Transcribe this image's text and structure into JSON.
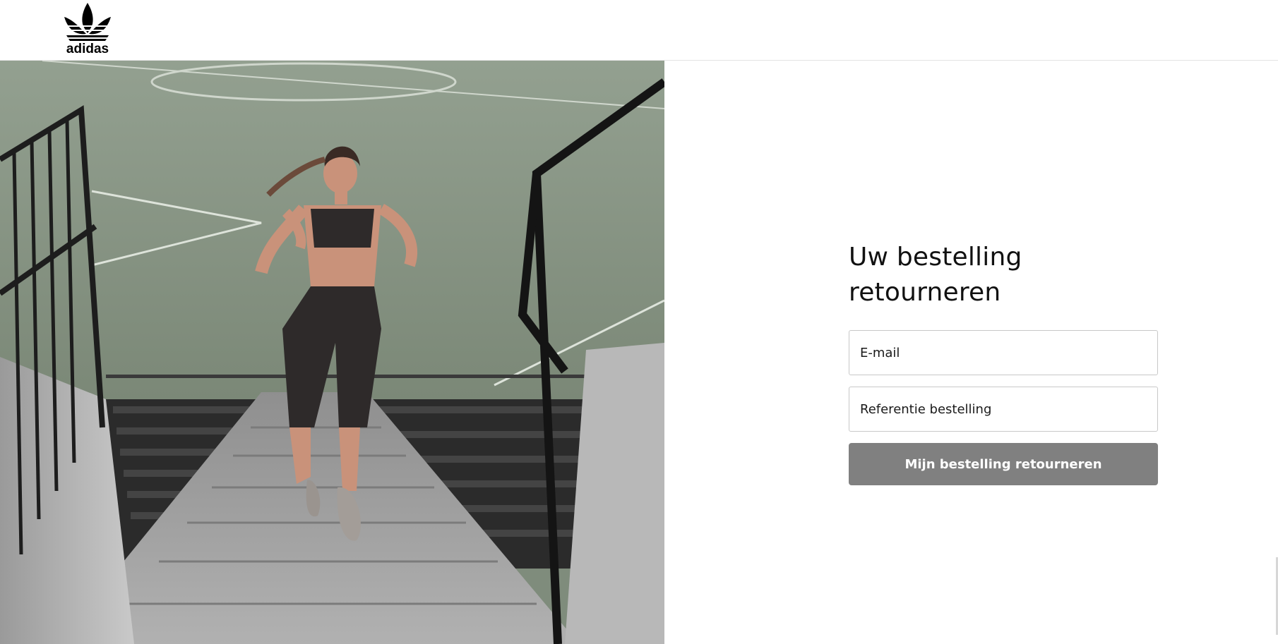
{
  "header": {
    "logo_text": "adidas",
    "logo_icon": "adidas-trefoil-icon"
  },
  "hero": {
    "image": "woman-running-up-stadium-stairs"
  },
  "form": {
    "title": "Uw bestelling retourneren",
    "email_placeholder": "E-mail",
    "email_value": "",
    "reference_placeholder": "Referentie bestelling",
    "reference_value": "",
    "submit_label": "Mijn bestelling retourneren"
  },
  "colors": {
    "button_bg": "#808080",
    "button_text": "#ffffff",
    "field_border": "#c8c8c8",
    "title_text": "#111111"
  }
}
